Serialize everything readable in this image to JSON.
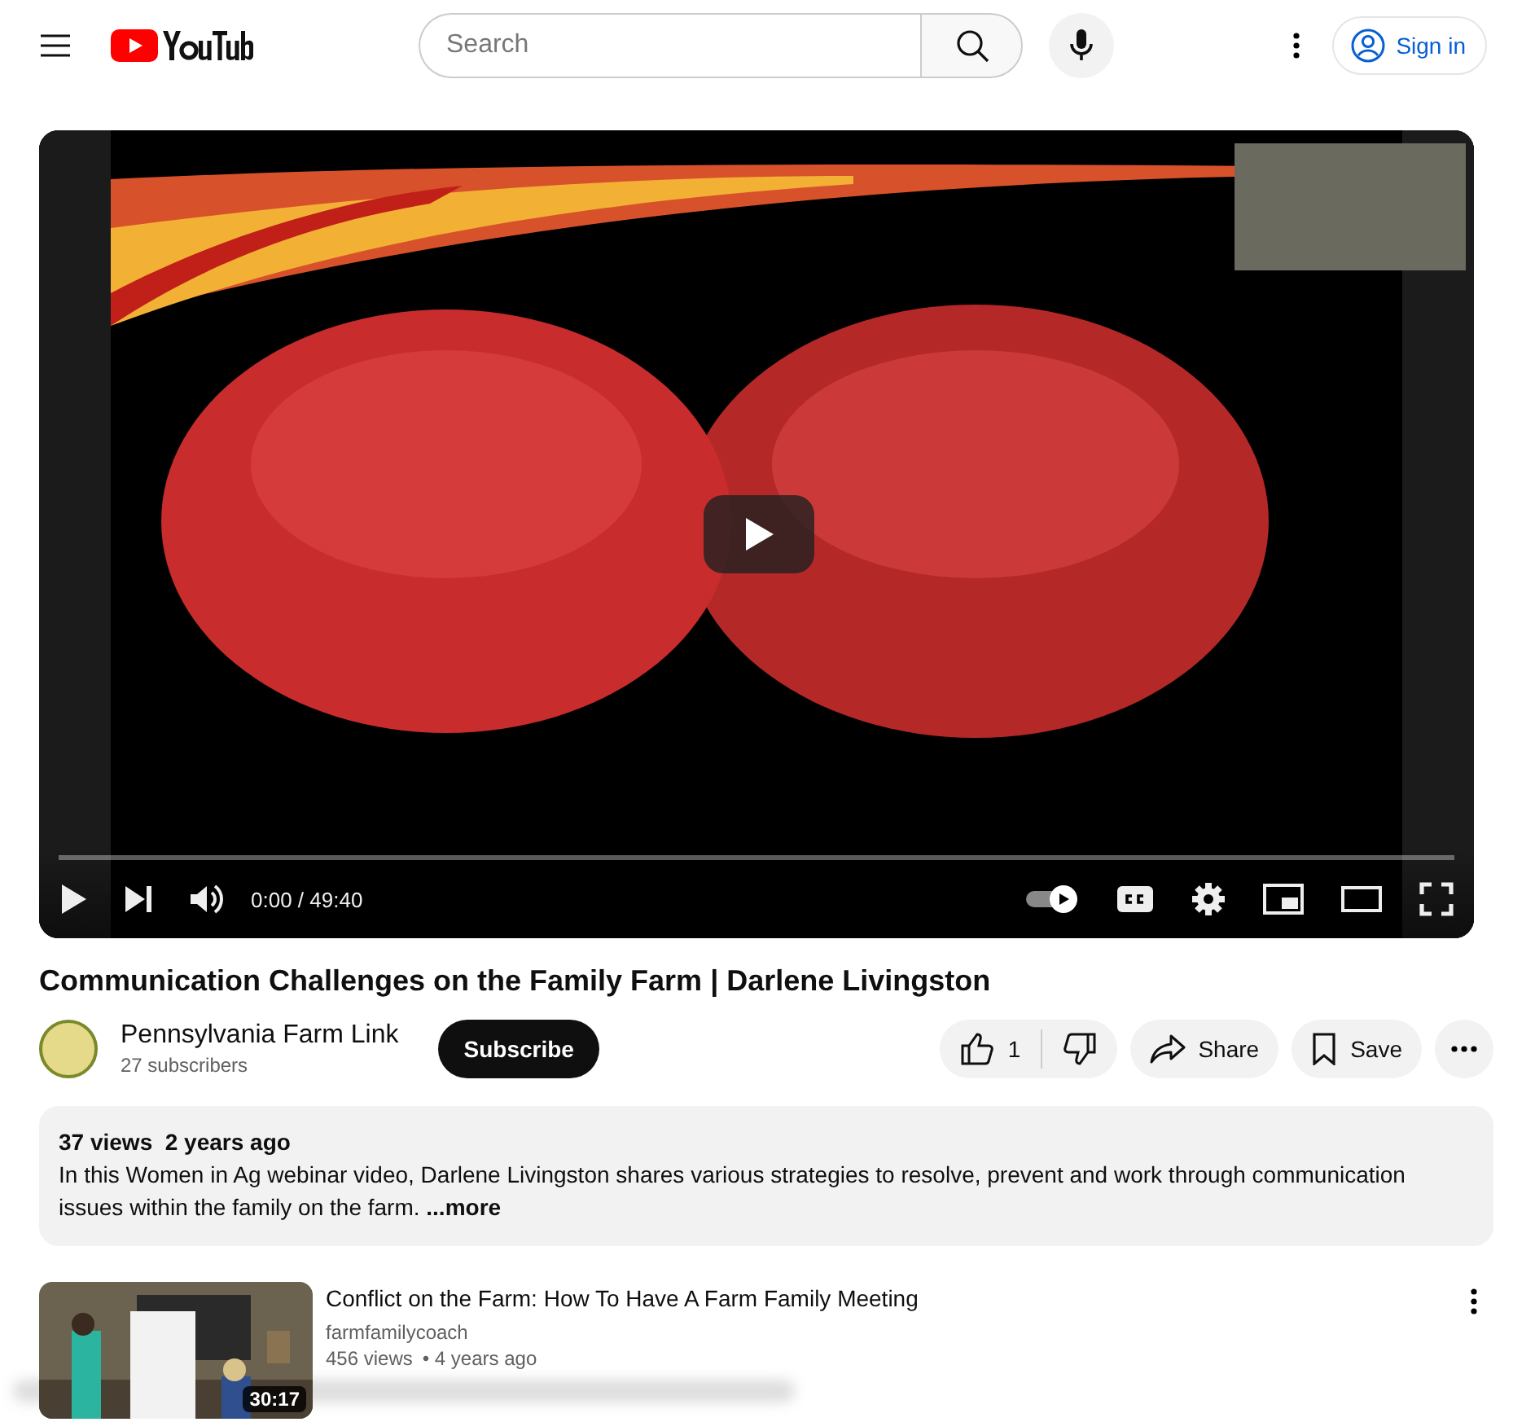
{
  "header": {
    "search": {
      "placeholder": "Search"
    },
    "sign_in": "Sign in"
  },
  "player": {
    "time": "0:00 / 49:40",
    "level": 0,
    "autoplay": true,
    "volume_muted": false
  },
  "video": {
    "title": "Communication Challenges on the Family Farm | Darlene Livingston",
    "channel": "Pennsylvania Farm Link",
    "subscribers": "27 subscribers",
    "subscribe": "Subscribe",
    "likes": "1",
    "share": "Share",
    "save": "Save"
  },
  "description": {
    "views": "37 views",
    "age": "2 years ago",
    "text": "In this Women in Ag webinar video, Darlene Livingston shares various strategies to resolve, prevent and work through communication issues within the family on the farm.",
    "more": "...more"
  },
  "related": [
    {
      "title": "Conflict on the Farm: How To Have A Farm Family Meeting",
      "channel": "farmfamilycoach",
      "views": "456 views",
      "age": "• 4 years ago",
      "duration": "30:17"
    }
  ]
}
